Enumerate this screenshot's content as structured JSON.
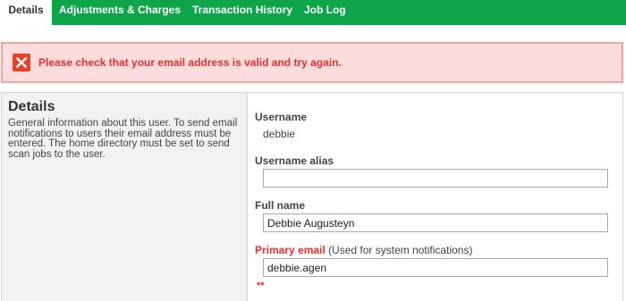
{
  "tabs": [
    {
      "label": "Details",
      "active": true
    },
    {
      "label": "Adjustments & Charges",
      "active": false
    },
    {
      "label": "Transaction History",
      "active": false
    },
    {
      "label": "Job Log",
      "active": false
    }
  ],
  "error": {
    "icon": "error-x-icon",
    "message": "Please check that your email address is valid and try again."
  },
  "details": {
    "title": "Details",
    "description": "General information about this user. To send email notifications to users their email address must be entered. The home directory must be set to send scan jobs to the user."
  },
  "fields": {
    "username": {
      "label": "Username",
      "value": "debbie"
    },
    "alias": {
      "label": "Username alias",
      "value": ""
    },
    "full_name": {
      "label": "Full name",
      "value": "Debbie Augusteyn"
    },
    "email": {
      "label": "Primary email",
      "note": "(Used for system notifications)",
      "value": "debbie.agen",
      "error_marks": "**"
    }
  },
  "colors": {
    "tab_bar": "#0da44a",
    "error_background": "#fcdcdc",
    "error_border": "#f3a3a3",
    "error_text": "#e8302c",
    "panel_left_background": "#f2f2f2"
  }
}
